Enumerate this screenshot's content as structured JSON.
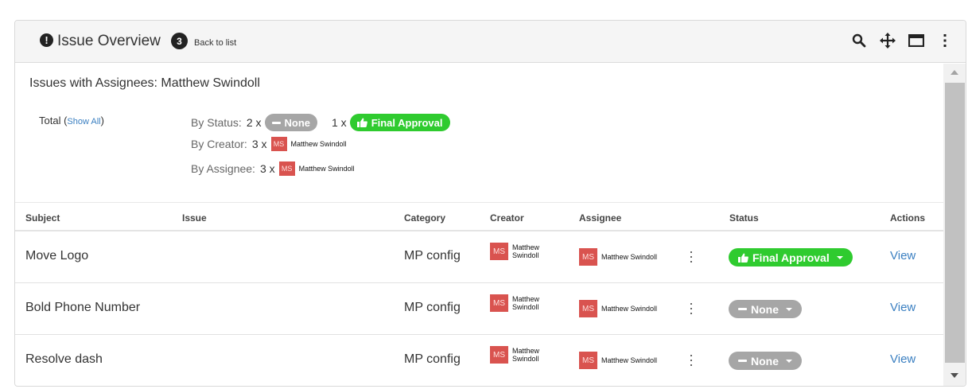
{
  "header": {
    "title": "Issue Overview",
    "count": "3",
    "back_label": "Back to list",
    "icons": [
      "search-icon",
      "move-icon",
      "window-icon",
      "more-vert-icon"
    ]
  },
  "summary": {
    "title": "Issues with Assignees: Matthew Swindoll",
    "total_label": "Total",
    "show_all": "Show All",
    "by_status_label": "By Status:",
    "status_counts": [
      {
        "count": "2 x",
        "label": "None",
        "color": "#a6a6a6"
      },
      {
        "count": "1 x",
        "label": "Final Approval",
        "color": "#2fcb2f"
      }
    ],
    "by_creator_label": "By Creator:",
    "by_creator_count": "3 x",
    "by_creator_name": "Matthew Swindoll",
    "by_assignee_label": "By Assignee:",
    "by_assignee_count": "3 x",
    "by_assignee_name": "Matthew Swindoll",
    "avatar_initials": "MS"
  },
  "table": {
    "columns": [
      "Subject",
      "Issue",
      "Category",
      "Creator",
      "Assignee",
      "Status",
      "Actions"
    ],
    "rows": [
      {
        "subject": "Move Logo",
        "issue": "",
        "category": "MP config",
        "creator_first": "Matthew",
        "creator_last": "Swindoll",
        "assignee": "Matthew Swindoll",
        "status": "Final Approval",
        "action": "View"
      },
      {
        "subject": "Bold Phone Number",
        "issue": "",
        "category": "MP config",
        "creator_first": "Matthew",
        "creator_last": "Swindoll",
        "assignee": "Matthew Swindoll",
        "status": "None",
        "action": "View"
      },
      {
        "subject": "Resolve dash",
        "issue": "",
        "category": "MP config",
        "creator_first": "Matthew",
        "creator_last": "Swindoll",
        "assignee": "Matthew Swindoll",
        "status": "None",
        "action": "View"
      }
    ]
  },
  "colors": {
    "status_none": "#a6a6a6",
    "status_final_approval": "#2fcb2f",
    "avatar": "#d9534f",
    "link": "#3a7fc1"
  }
}
